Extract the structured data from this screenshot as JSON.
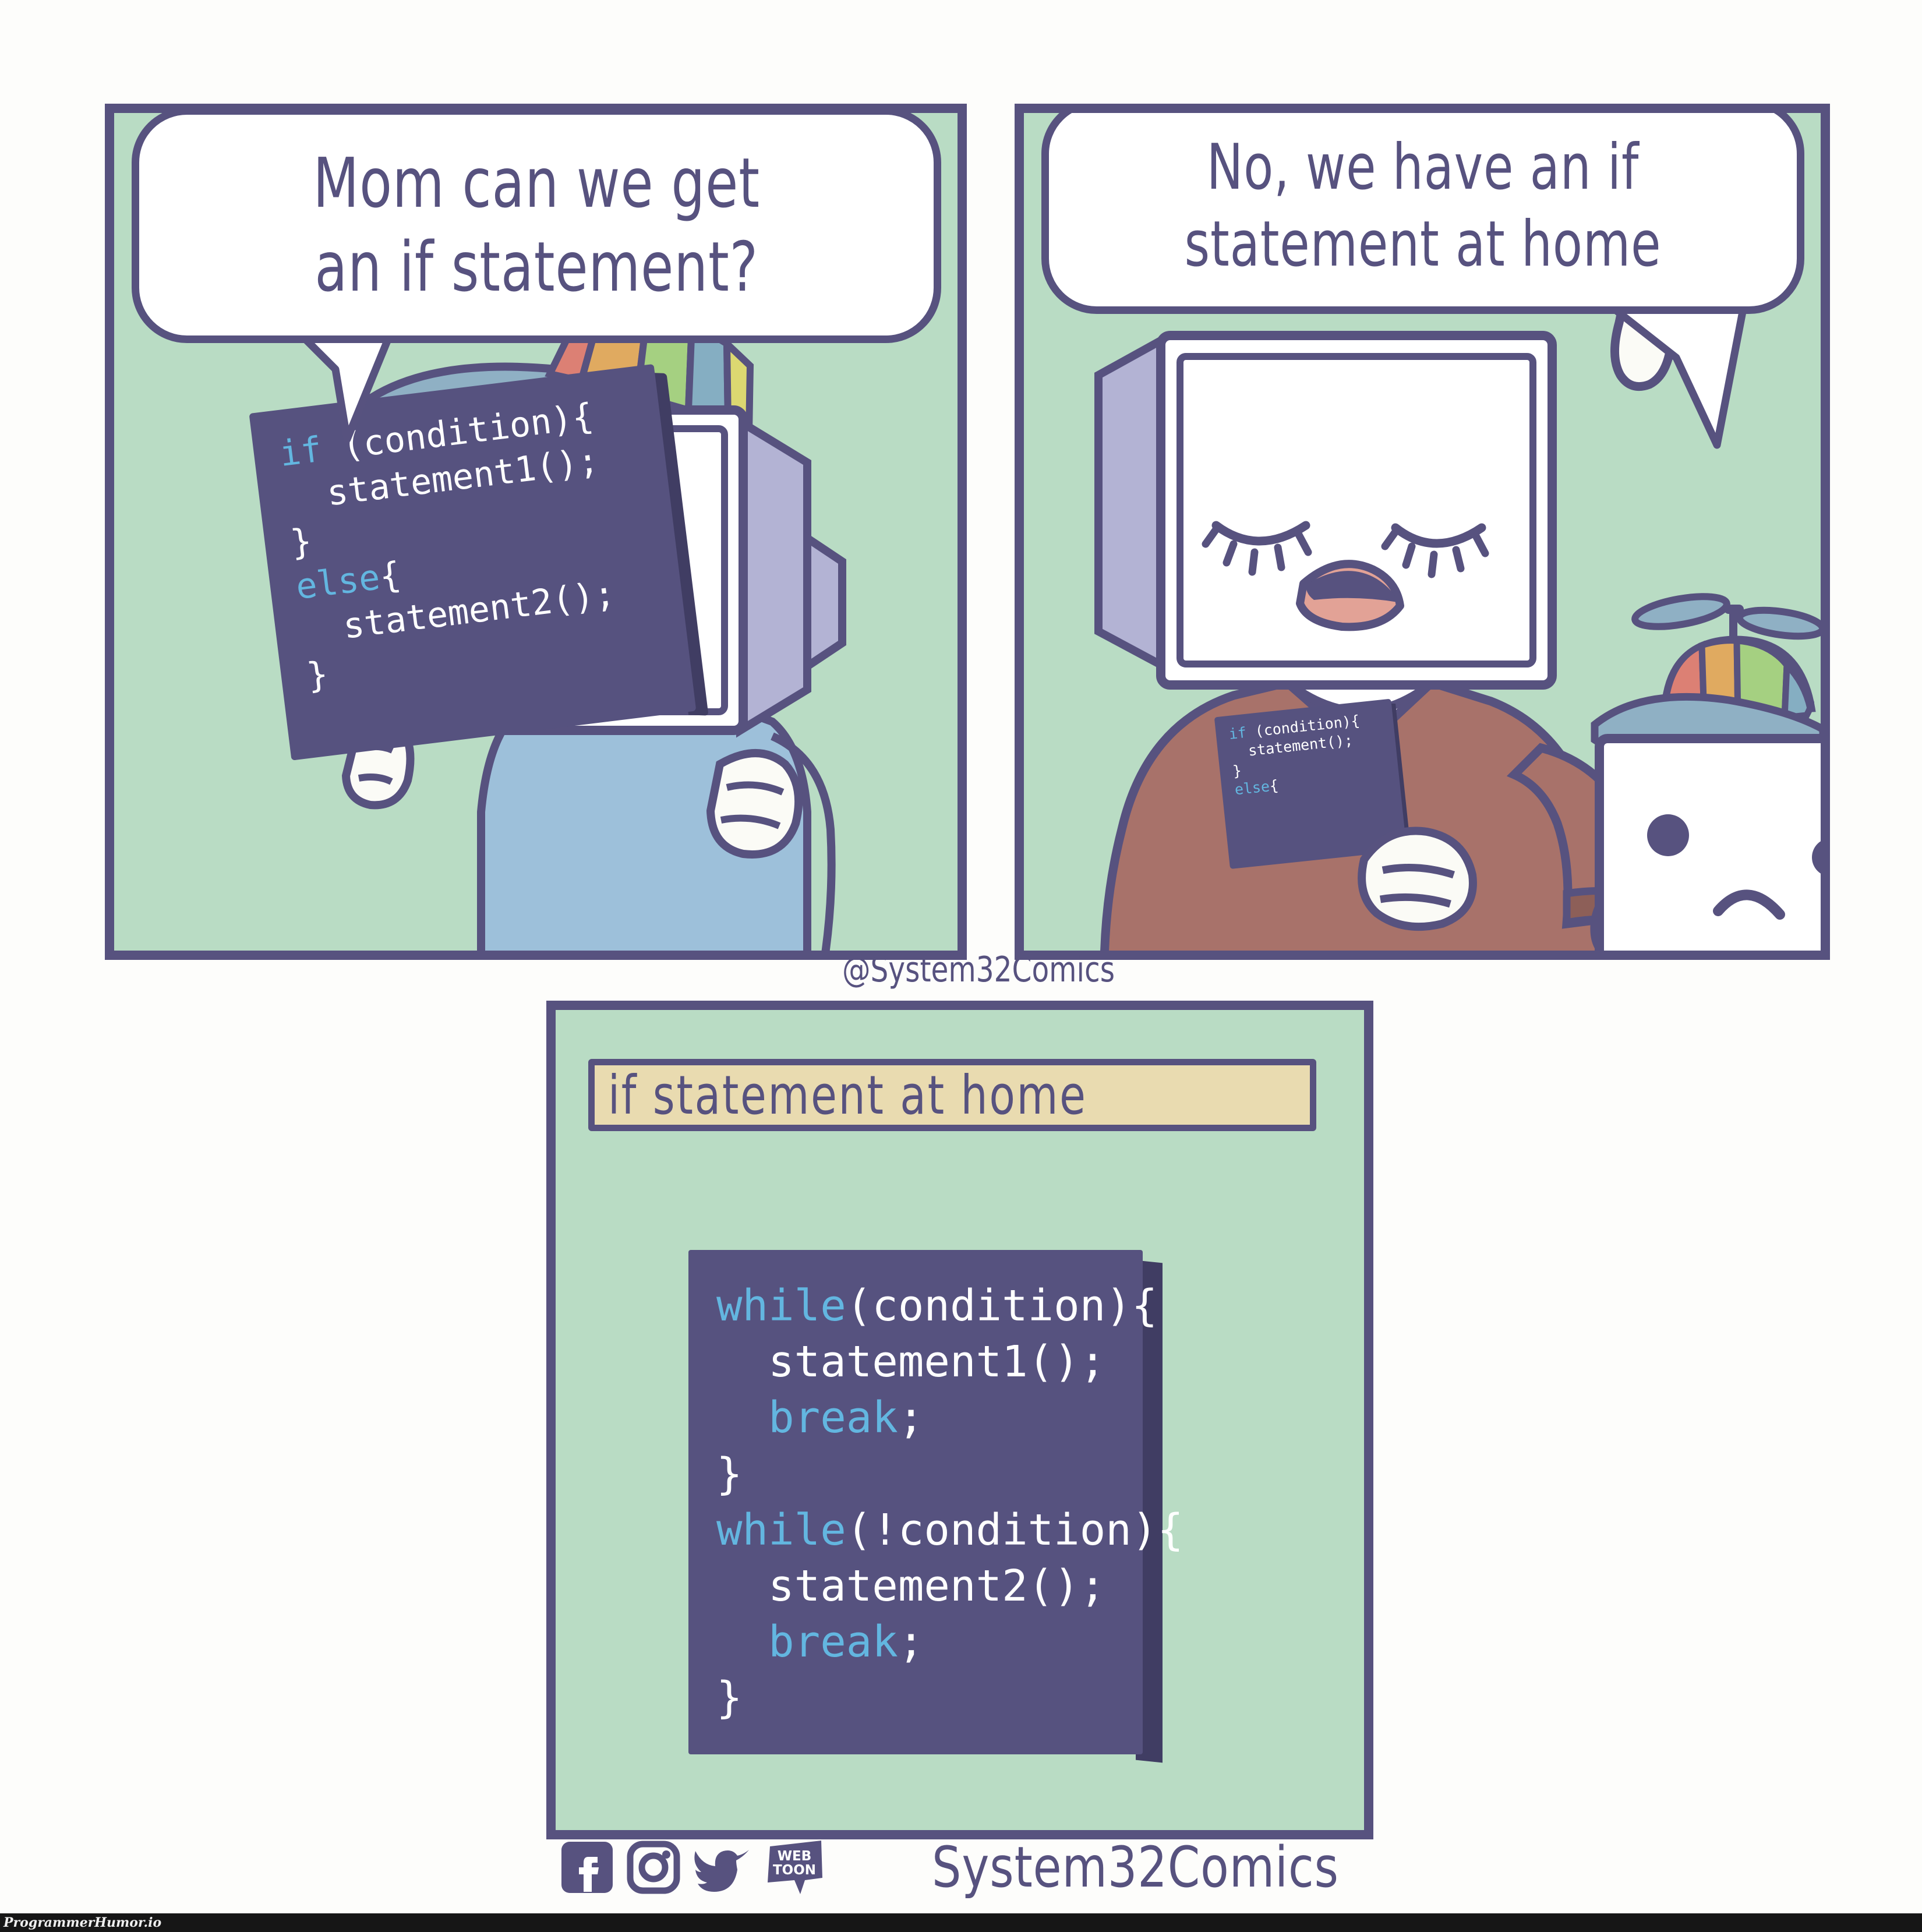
{
  "comic": {
    "watermark": "@System32Comics",
    "brand": "System32Comics",
    "source_bar": "ProgrammerHumor.io",
    "colors": {
      "ink": "#57527f",
      "panel_bg": "#b9dcc4",
      "slab_face": "#56527f",
      "slab_side": "#403d63",
      "title_bar_bg": "#e9dbb0",
      "keyword": "#63b6e0",
      "code_text": "#ffffff",
      "mom_sweater": "#a8726a",
      "kid_shirt": "#9dc0da",
      "monitor_face": "#ffffff",
      "monitor_side": "#b3b3d4",
      "mouth_pink": "#e2a296",
      "hat_brim": "#8fb0c4",
      "hat_red": "#dc8074",
      "hat_orange": "#e0aa60",
      "hat_green": "#a5d081",
      "hat_blue": "#85aec2",
      "hat_yellow": "#dcd871"
    }
  },
  "panels": [
    {
      "id": "panel-1",
      "bubble": "Mom can we get\nan if statement?",
      "character": "kid-monitor-happy",
      "code_lines": [
        {
          "indent": 0,
          "kw": "if",
          "rest": " (condition){"
        },
        {
          "indent": 1,
          "kw": "",
          "rest": "statement1();"
        },
        {
          "indent": 0,
          "kw": "",
          "rest": "}"
        },
        {
          "indent": 0,
          "kw": "else",
          "rest": "{"
        },
        {
          "indent": 1,
          "kw": "",
          "rest": "statement2();"
        },
        {
          "indent": 0,
          "kw": "",
          "rest": "}"
        }
      ]
    },
    {
      "id": "panel-2",
      "bubble": "No, we have an if\nstatement at home",
      "character": "mom-monitor-stern",
      "secondary_character": "kid-monitor-sad",
      "code_lines": [
        {
          "indent": 0,
          "kw": "if",
          "rest": " (condition){"
        },
        {
          "indent": 1,
          "kw": "",
          "rest": "statement();"
        },
        {
          "indent": 0,
          "kw": "",
          "rest": "}"
        },
        {
          "indent": 0,
          "kw": "else",
          "rest": "{"
        }
      ]
    },
    {
      "id": "panel-3",
      "title": "if statement at home",
      "code_lines": [
        {
          "indent": 0,
          "kw": "while",
          "rest": "(condition){"
        },
        {
          "indent": 1,
          "kw": "",
          "rest": "statement1();"
        },
        {
          "indent": 1,
          "kw": "break",
          "rest": ";"
        },
        {
          "indent": 0,
          "kw": "",
          "rest": "}"
        },
        {
          "indent": 0,
          "kw": "while",
          "rest": "(!condition){"
        },
        {
          "indent": 1,
          "kw": "",
          "rest": "statement2();"
        },
        {
          "indent": 1,
          "kw": "break",
          "rest": ";"
        },
        {
          "indent": 0,
          "kw": "",
          "rest": "}"
        }
      ]
    }
  ],
  "social_icons": [
    {
      "name": "facebook-icon",
      "label": "Facebook"
    },
    {
      "name": "instagram-icon",
      "label": "Instagram"
    },
    {
      "name": "twitter-icon",
      "label": "Twitter"
    },
    {
      "name": "webtoon-icon",
      "label": "WEBTOON",
      "line1": "WEB",
      "line2": "TOON"
    }
  ]
}
